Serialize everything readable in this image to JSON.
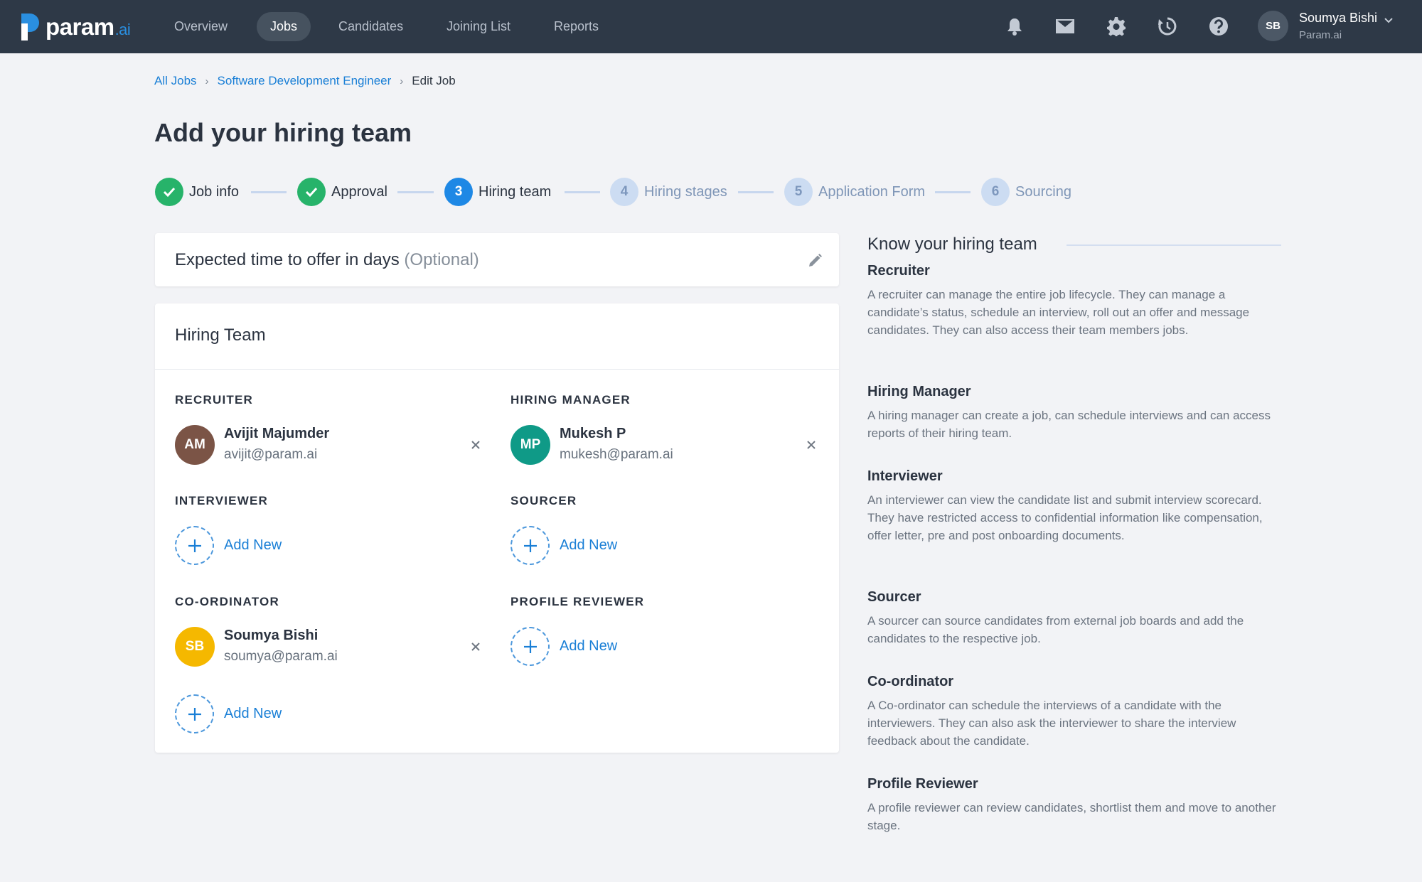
{
  "brand": {
    "name": "param",
    "suffix": ".ai"
  },
  "nav": {
    "items": [
      {
        "label": "Overview",
        "active": false
      },
      {
        "label": "Jobs",
        "active": true
      },
      {
        "label": "Candidates",
        "active": false
      },
      {
        "label": "Joining List",
        "active": false
      },
      {
        "label": "Reports",
        "active": false
      }
    ],
    "icons": [
      "bell-icon",
      "mail-icon",
      "gear-icon",
      "history-icon",
      "help-icon"
    ]
  },
  "user": {
    "initials": "SB",
    "name": "Soumya Bishi",
    "org": "Param.ai"
  },
  "breadcrumb": {
    "items": [
      "All Jobs",
      "Software Development Engineer"
    ],
    "current": "Edit Job"
  },
  "page": {
    "title": "Add your hiring team"
  },
  "steps": [
    {
      "number": "1",
      "label": "Job info",
      "state": "done"
    },
    {
      "number": "2",
      "label": "Approval",
      "state": "done"
    },
    {
      "number": "3",
      "label": "Hiring team",
      "state": "current"
    },
    {
      "number": "4",
      "label": "Hiring stages",
      "state": "todo"
    },
    {
      "number": "5",
      "label": "Application Form",
      "state": "todo"
    },
    {
      "number": "6",
      "label": "Sourcing",
      "state": "todo"
    }
  ],
  "offer": {
    "title": "Expected time to offer in days",
    "optional": "(Optional)"
  },
  "team": {
    "title": "Hiring Team",
    "add_label": "Add New",
    "recruiter": {
      "label": "RECRUITER",
      "initials": "AM",
      "name": "Avijit Majumder",
      "email": "avijit@param.ai",
      "color": "#7b5446"
    },
    "hiring_manager": {
      "label": "HIRING MANAGER",
      "initials": "MP",
      "name": "Mukesh P",
      "email": "mukesh@param.ai",
      "color": "#0f9a87"
    },
    "interviewer": {
      "label": "INTERVIEWER"
    },
    "sourcer": {
      "label": "SOURCER"
    },
    "coordinator": {
      "label": "CO-ORDINATOR",
      "initials": "SB",
      "name": "Soumya Bishi",
      "email": "soumya@param.ai",
      "color": "#f5b800"
    },
    "profile_reviewer": {
      "label": "PROFILE REVIEWER"
    }
  },
  "info": {
    "heading": "Know your hiring team",
    "roles": [
      {
        "title": "Recruiter",
        "desc": "A recruiter can manage the entire job lifecycle. They can manage a candidate’s status, schedule an interview, roll out an offer and message candidates. They can also access their team members jobs."
      },
      {
        "title": "Hiring Manager",
        "desc": "A hiring manager can create a job, can schedule interviews and can access reports of their hiring team."
      },
      {
        "title": "Interviewer",
        "desc": "An interviewer can view the candidate list and submit interview scorecard. They have restricted access to confidential information like compensation, offer letter, pre and post onboarding documents."
      },
      {
        "title": "Sourcer",
        "desc": "A sourcer can source candidates from external job boards and add the candidates to the respective job."
      },
      {
        "title": "Co-ordinator",
        "desc": "A Co-ordinator can schedule the interviews of a candidate with the interviewers. They can also ask the interviewer to share the interview feedback about the candidate."
      },
      {
        "title": "Profile Reviewer",
        "desc": "A profile reviewer can review candidates, shortlist them and move to another stage."
      }
    ]
  },
  "colors": {
    "nav_bg": "#2e3947",
    "accent": "#1e88e5",
    "success": "#27b36a",
    "link": "#1a7fd6"
  }
}
